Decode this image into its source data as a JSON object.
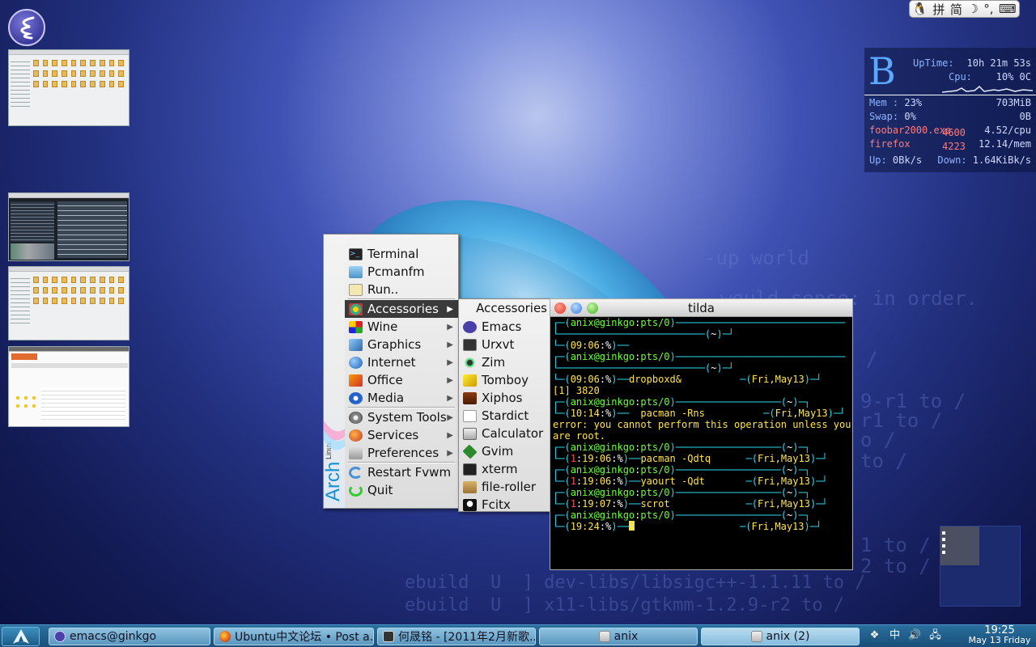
{
  "ime_bar": {
    "items": [
      "拼",
      "简",
      "☽",
      "°,",
      "⌨"
    ]
  },
  "conky": {
    "logo": "B",
    "uptime_label": "UpTime:",
    "uptime_value": "10h 21m 53s",
    "cpu_label": "Cpu:",
    "cpu_value": "10% 0C",
    "mem_label": "Mem :",
    "mem_pct": "23%",
    "mem_value": "703MiB",
    "swap_label": "Swap:",
    "swap_pct": "0%",
    "swap_value": "0B",
    "proc1_name": "foobar2000.exe",
    "proc1_pid": "4600",
    "proc1_value": "4.52/cpu",
    "proc2_name": "firefox",
    "proc2_pid": "4223",
    "proc2_value": "12.14/mem",
    "up_label": "Up:",
    "up_value": "0Bk/s",
    "down_label": "Down:",
    "down_value": "1.64KiBk/s"
  },
  "menu": {
    "logo_text": "Arch",
    "logo_sub": "Linux",
    "items": [
      {
        "label": "Terminal"
      },
      {
        "label": "Pcmanfm"
      },
      {
        "label": "Run.."
      },
      {
        "label": "Accessories"
      },
      {
        "label": "Wine"
      },
      {
        "label": "Graphics"
      },
      {
        "label": "Internet"
      },
      {
        "label": "Office"
      },
      {
        "label": "Media"
      },
      {
        "label": "System Tools"
      },
      {
        "label": "Services"
      },
      {
        "label": "Preferences"
      },
      {
        "label": "Restart Fvwm"
      },
      {
        "label": "Quit"
      }
    ],
    "arrow": "▶"
  },
  "submenu": {
    "title": "Accessories",
    "items": [
      "Emacs",
      "Urxvt",
      "Zim",
      "Tomboy",
      "Xiphos",
      "Stardict",
      "Calculator",
      "Gvim",
      "xterm",
      "file-roller",
      "Fcitx"
    ]
  },
  "tilda": {
    "title": "tilda",
    "prompt_user": "anix@ginkgo",
    "prompt_tty": "pts/0",
    "home": "~",
    "date": "Fri,May13",
    "lines": {
      "t1": "09:06",
      "t2": "09:06",
      "cmd2": "dropboxd&",
      "job": "[1] 3820",
      "t3": "10:14",
      "cmd3": "pacman -Rns",
      "err": "error: you cannot perform this operation unless you",
      "err2": "are root.",
      "t4": "19:06",
      "cmd4": "pacman -Qdtq",
      "ret4": "1",
      "t5": "19:06",
      "cmd5": "yaourt -Qdt",
      "ret5": "1",
      "t6": "19:07",
      "cmd6": "scrot",
      "ret6": "1",
      "t7": "19:24"
    },
    "pct": "%"
  },
  "background_code": [
    "-up world",
    "would sense: in order.",
    "/",
    "9-r1 to /",
    "r1 to /",
    "o /",
    "to /",
    "1 to /",
    "2 to /",
    "ebuild  U  ] dev-libs/libsigc++-1.1.11 to /",
    "ebuild  U  ] x11-libs/gtkmm-1.2.9-r2 to /"
  ],
  "taskbar": {
    "tasks": [
      {
        "label": "emacs@ginkgo"
      },
      {
        "label": "Ubuntu中文论坛 • Post a..."
      },
      {
        "label": "何晟铭 - [2011年2月新歌..."
      },
      {
        "label": "anix"
      },
      {
        "label": "anix (2)"
      }
    ],
    "clock_time": "19:25",
    "clock_date": "May 13 Friday"
  }
}
